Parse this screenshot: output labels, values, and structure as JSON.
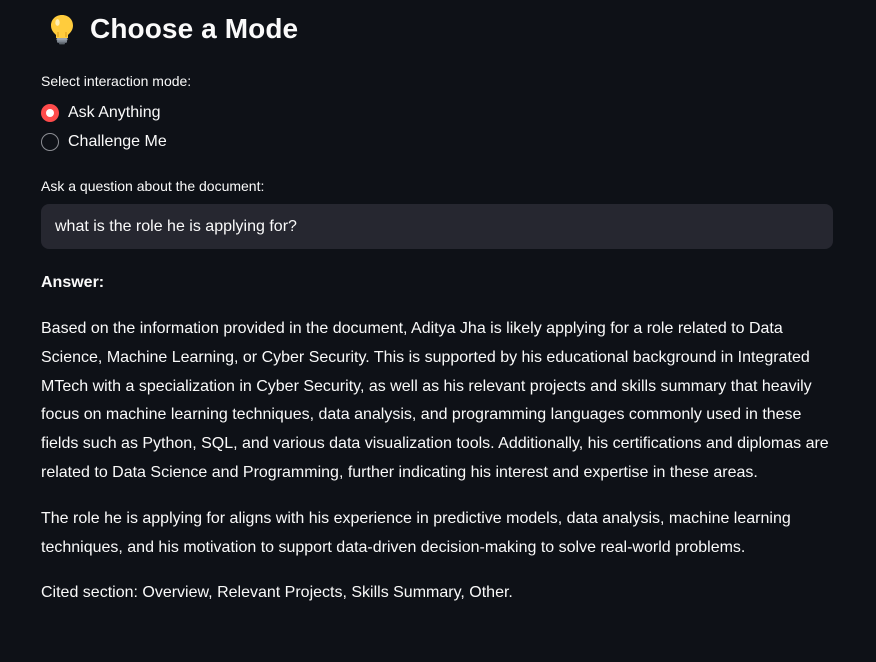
{
  "header": {
    "icon": "lightbulb-icon",
    "title": "Choose a Mode"
  },
  "mode": {
    "label": "Select interaction mode:",
    "options": [
      {
        "label": "Ask Anything",
        "selected": true
      },
      {
        "label": "Challenge Me",
        "selected": false
      }
    ]
  },
  "question": {
    "label": "Ask a question about the document:",
    "value": "what is the role he is applying for?"
  },
  "answer": {
    "heading": "Answer:",
    "paragraphs": [
      "Based on the information provided in the document, Aditya Jha is likely applying for a role related to Data Science, Machine Learning, or Cyber Security. This is supported by his educational background in Integrated MTech with a specialization in Cyber Security, as well as his relevant projects and skills summary that heavily focus on machine learning techniques, data analysis, and programming languages commonly used in these fields such as Python, SQL, and various data visualization tools. Additionally, his certifications and diplomas are related to Data Science and Programming, further indicating his interest and expertise in these areas.",
      "The role he is applying for aligns with his experience in predictive models, data analysis, machine learning techniques, and his motivation to support data-driven decision-making to solve real-world problems.",
      "Cited section: Overview, Relevant Projects, Skills Summary, Other."
    ]
  },
  "colors": {
    "background": "#0e1117",
    "accent": "#ff4b4b",
    "input_background": "#262730",
    "text": "#fafafa"
  }
}
